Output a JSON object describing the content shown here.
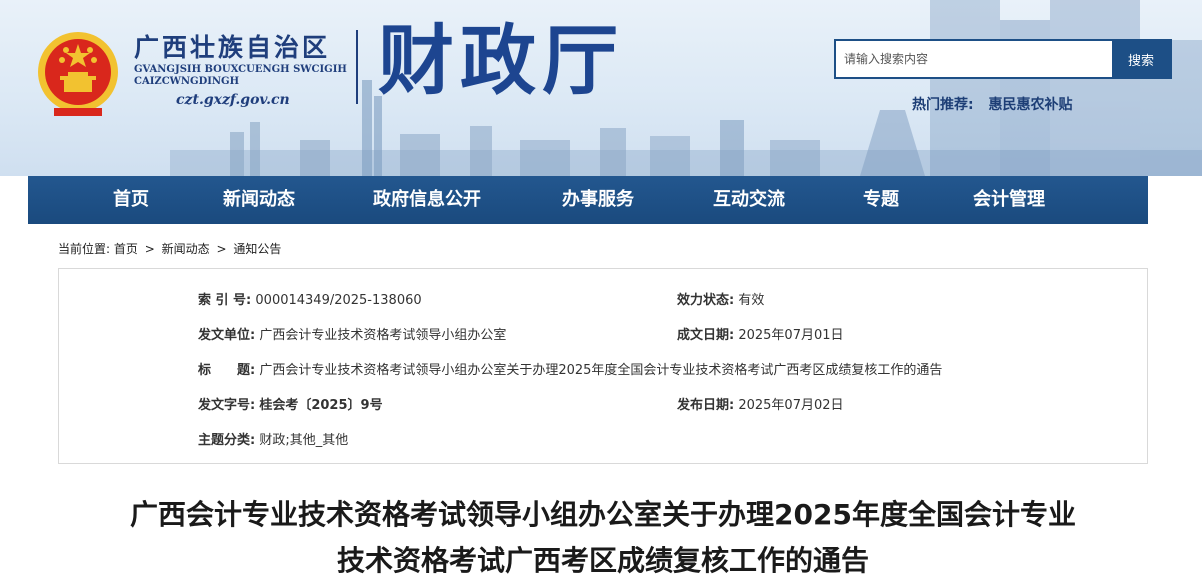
{
  "header": {
    "region_name": "广西壮族自治区",
    "pinyin_line1": "GVANGJSIH BOUXCUENGH SWCIGIH",
    "pinyin_line2": "CAIZCWNGDINGH",
    "domain": "czt.gxzf.gov.cn",
    "dept_name": "财政厅",
    "search_placeholder": "请输入搜索内容",
    "search_button": "搜索",
    "hot_label": "热门推荐:",
    "hot_link": "惠民惠农补贴"
  },
  "nav": {
    "items": [
      "首页",
      "新闻动态",
      "政府信息公开",
      "办事服务",
      "互动交流",
      "专题",
      "会计管理"
    ]
  },
  "breadcrumb": {
    "prefix": "当前位置:",
    "items": [
      "首页",
      "新闻动态",
      "通知公告"
    ],
    "separator": ">"
  },
  "meta": {
    "index_no_label": "索 引 号:",
    "index_no": "000014349/2025-138060",
    "status_label": "效力状态:",
    "status": "有效",
    "issuer_label": "发文单位:",
    "issuer": "广西会计专业技术资格考试领导小组办公室",
    "created_label": "成文日期:",
    "created": "2025年07月01日",
    "title_label": "标　　题:",
    "title": "广西会计专业技术资格考试领导小组办公室关于办理2025年度全国会计专业技术资格考试广西考区成绩复核工作的通告",
    "doc_no_label": "发文字号:",
    "doc_no": "桂会考〔2025〕9号",
    "published_label": "发布日期:",
    "published": "2025年07月02日",
    "category_label": "主题分类:",
    "category": "财政;其他_其他"
  },
  "article": {
    "title_line1": "广西会计专业技术资格考试领导小组办公室关于办理2025年度全国会计专业",
    "title_line2": "技术资格考试广西考区成绩复核工作的通告"
  },
  "colors": {
    "nav_blue": "#1d4f86",
    "title_blue": "#1d4590",
    "emblem_red": "#d9271c",
    "emblem_gold": "#f2c230"
  },
  "icons": {
    "emblem": "national-emblem-icon"
  }
}
